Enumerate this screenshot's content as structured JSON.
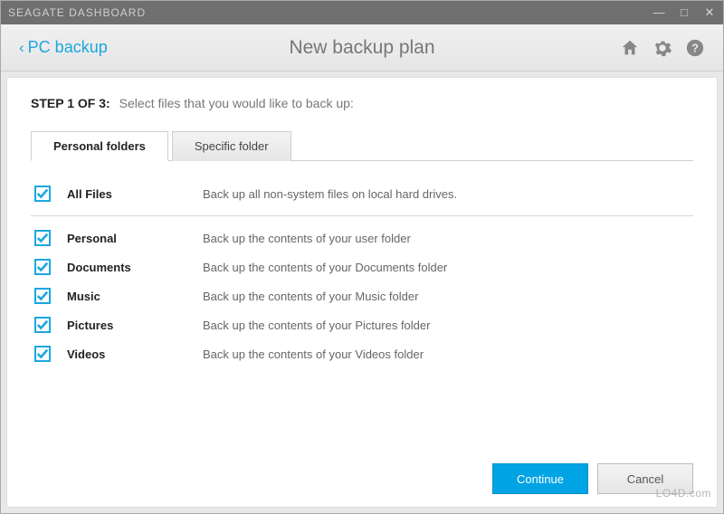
{
  "titlebar": {
    "title": "SEAGATE DASHBOARD"
  },
  "subheader": {
    "back_label": "PC backup",
    "page_title": "New backup plan"
  },
  "step": {
    "label": "STEP 1 OF 3:",
    "desc": "Select files that you would like to back up:"
  },
  "tabs": {
    "personal": "Personal folders",
    "specific": "Specific folder"
  },
  "all_files": {
    "name": "All Files",
    "desc": "Back up all non-system files on local hard drives.",
    "checked": true
  },
  "folders": [
    {
      "name": "Personal",
      "desc": "Back up the contents of your user folder",
      "checked": true
    },
    {
      "name": "Documents",
      "desc": "Back up the contents of your Documents folder",
      "checked": true
    },
    {
      "name": "Music",
      "desc": "Back up the contents of your Music folder",
      "checked": true
    },
    {
      "name": "Pictures",
      "desc": "Back up the contents of your Pictures folder",
      "checked": true
    },
    {
      "name": "Videos",
      "desc": "Back up the contents of your Videos folder",
      "checked": true
    }
  ],
  "buttons": {
    "continue": "Continue",
    "cancel": "Cancel"
  },
  "watermark": "LO4D.com"
}
